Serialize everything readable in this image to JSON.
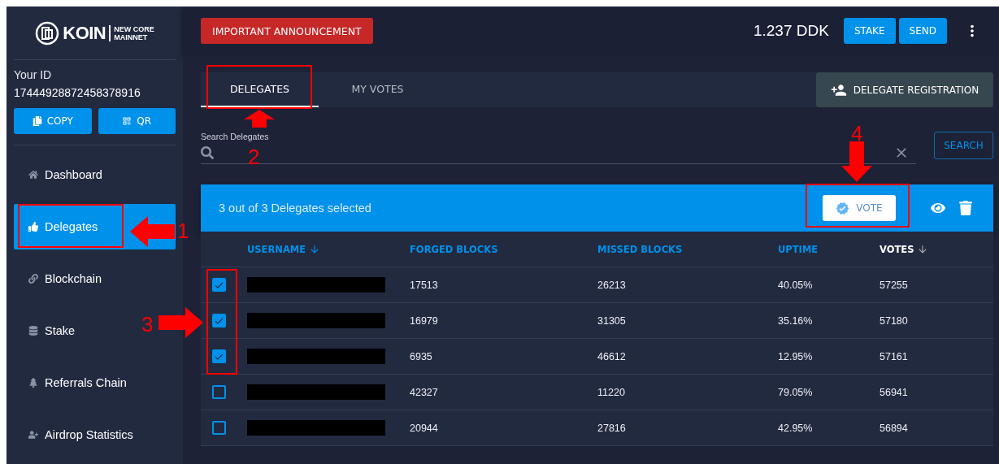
{
  "logo": {
    "brand": "KOIN",
    "edition_top": "NEW CORE",
    "edition_bottom": "MAINNET"
  },
  "account": {
    "label": "Your ID",
    "id": "17444928872458378916",
    "buttons": [
      "COPY",
      "QR"
    ]
  },
  "sidebar": {
    "items": [
      {
        "label": "Dashboard",
        "selected": false,
        "kind": "home"
      },
      {
        "label": "Delegates",
        "selected": true,
        "kind": "thumb"
      },
      {
        "label": "Blockchain",
        "selected": false,
        "kind": "link"
      },
      {
        "label": "Stake",
        "selected": false,
        "kind": "stack"
      },
      {
        "label": "Referrals Chain",
        "selected": false,
        "kind": "tree"
      },
      {
        "label": "Airdrop Statistics",
        "selected": false,
        "kind": "user"
      }
    ]
  },
  "header": {
    "announcement": "IMPORTANT ANNOUNCEMENT",
    "balance": "1.237 DDK",
    "buttons": [
      "STAKE",
      "SEND"
    ]
  },
  "tabs": [
    {
      "label": "DELEGATES",
      "selected": true
    },
    {
      "label": "MY VOTES",
      "selected": false
    }
  ],
  "registration_button": "DELEGATE REGISTRATION",
  "search": {
    "label": "Search Delegates",
    "button": "SEARCH"
  },
  "selection_bar": {
    "text": "3 out of 3 Delegates selected",
    "vote_button": "VOTE"
  },
  "table": {
    "columns": [
      {
        "label": "USERNAME",
        "sorted": true,
        "active": false
      },
      {
        "label": "FORGED BLOCKS",
        "sorted": false,
        "active": false
      },
      {
        "label": "MISSED BLOCKS",
        "sorted": false,
        "active": false
      },
      {
        "label": "UPTIME",
        "sorted": false,
        "active": false
      },
      {
        "label": "VOTES",
        "sorted": true,
        "active": true
      }
    ],
    "rows": [
      {
        "checked": true,
        "forged": "17513",
        "missed": "26213",
        "uptime": "40.05%",
        "votes": "57255"
      },
      {
        "checked": true,
        "forged": "16979",
        "missed": "31305",
        "uptime": "35.16%",
        "votes": "57180"
      },
      {
        "checked": true,
        "forged": "6935",
        "missed": "46612",
        "uptime": "12.95%",
        "votes": "57161"
      },
      {
        "checked": false,
        "forged": "42327",
        "missed": "11220",
        "uptime": "79.05%",
        "votes": "56941"
      },
      {
        "checked": false,
        "forged": "20944",
        "missed": "27816",
        "uptime": "42.95%",
        "votes": "56894"
      }
    ]
  },
  "annotations": [
    {
      "label": "1"
    },
    {
      "label": "2"
    },
    {
      "label": "3"
    },
    {
      "label": "4"
    }
  ]
}
